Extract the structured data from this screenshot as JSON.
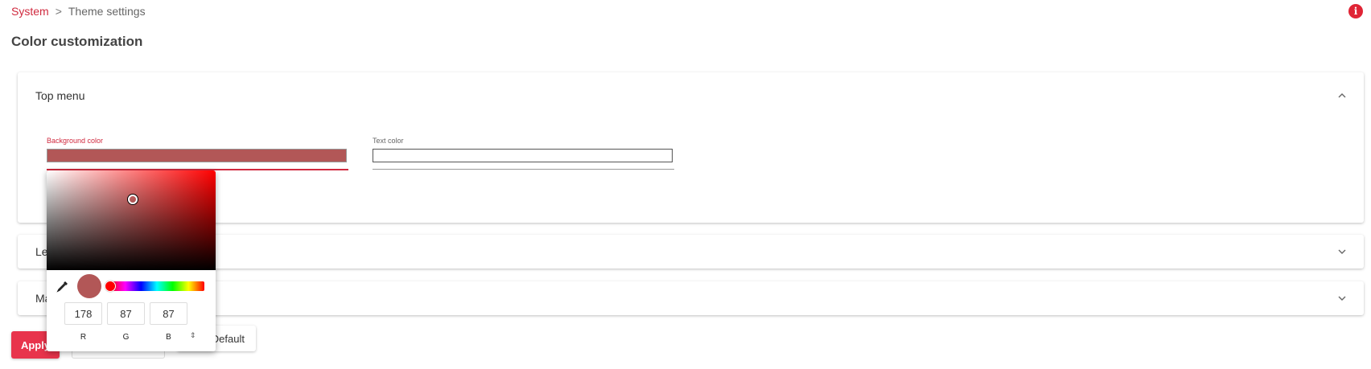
{
  "breadcrumb": {
    "parent": "System",
    "separator": ">",
    "current": "Theme settings"
  },
  "page_title": "Color customization",
  "panels": [
    {
      "title": "Top menu",
      "expanded": true,
      "fields": [
        {
          "label": "Background color",
          "value_color": "#b25757"
        },
        {
          "label": "Text color",
          "value_color": "#ffffff"
        }
      ]
    },
    {
      "title": "Le",
      "expanded": false
    },
    {
      "title": "Ma",
      "expanded": false
    }
  ],
  "buttons": {
    "apply": "Apply",
    "default": "Default"
  },
  "picker": {
    "hue_color": "#ff0000",
    "preview_color": "#b25757",
    "r": "178",
    "g": "87",
    "b": "87",
    "r_label": "R",
    "g_label": "G",
    "b_label": "B"
  },
  "colors": {
    "accent": "#d02a3f",
    "apply_bg": "#e8344c"
  }
}
